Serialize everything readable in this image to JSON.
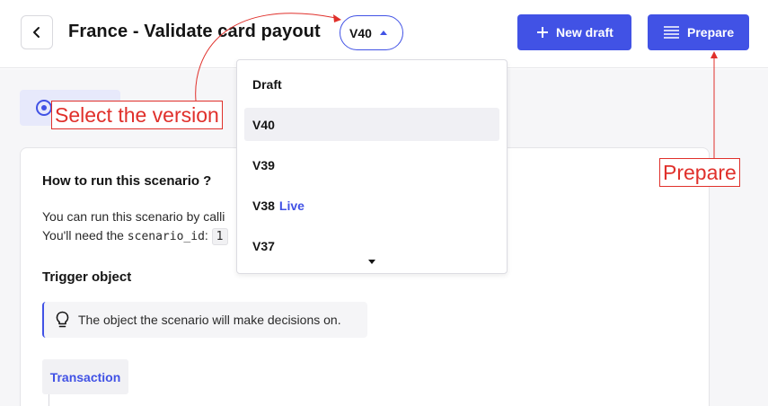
{
  "header": {
    "title": "France - Validate card payout",
    "version_selected": "V40",
    "new_draft_label": "New draft",
    "prepare_label": "Prepare"
  },
  "version_menu": {
    "items": [
      {
        "label": "Draft",
        "tag": ""
      },
      {
        "label": "V40",
        "tag": "",
        "selected": true
      },
      {
        "label": "V39",
        "tag": ""
      },
      {
        "label": "V38",
        "tag": "Live"
      },
      {
        "label": "V37",
        "tag": ""
      }
    ]
  },
  "main": {
    "how_to_title": "How to run this scenario ?",
    "line1": "You can run this scenario by calli",
    "line2_prefix": "You'll need the ",
    "line2_code": "scenario_id",
    "line2_colon": ": ",
    "line2_value": "1",
    "trigger_title": "Trigger object",
    "callout_text": "The object the scenario will make decisions on.",
    "trigger_tab": "Transaction"
  },
  "annotations": {
    "select_version": "Select the version",
    "prepare": "Prepare"
  },
  "colors": {
    "accent": "#4152e5",
    "annotation": "#e0302b"
  }
}
